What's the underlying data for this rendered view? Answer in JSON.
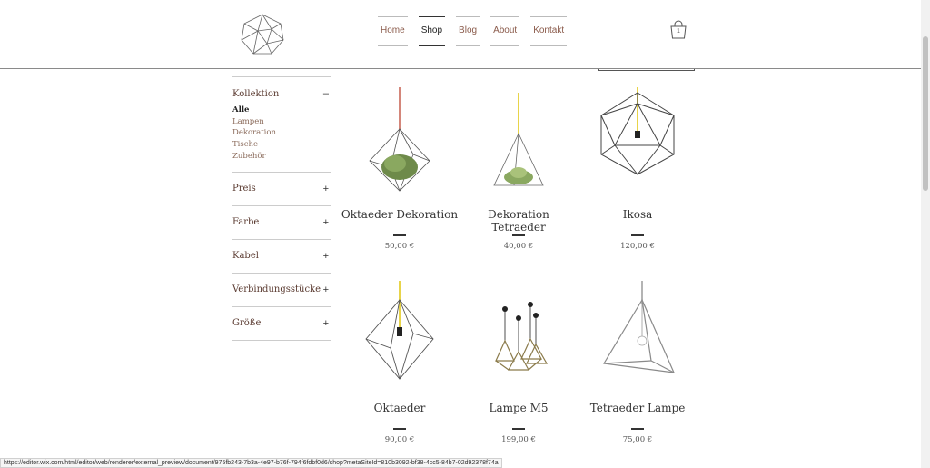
{
  "header": {
    "logo_icon": "geodesic-logo-icon",
    "nav": [
      "Home",
      "Shop",
      "Blog",
      "About",
      "Kontakt"
    ],
    "active_nav": "Shop",
    "cart_count": "1",
    "cart_icon": "shopping-bag-icon"
  },
  "sidebar": {
    "collection": {
      "label": "Kollektion",
      "toggle": "–",
      "items": [
        "Alle",
        "Lampen",
        "Dekoration",
        "Tische",
        "Zubehör"
      ],
      "active_item": "Alle"
    },
    "filters": [
      {
        "label": "Preis",
        "toggle": "+"
      },
      {
        "label": "Farbe",
        "toggle": "+"
      },
      {
        "label": "Kabel",
        "toggle": "+"
      },
      {
        "label": "Verbindungsstücke",
        "toggle": "+"
      },
      {
        "label": "Größe",
        "toggle": "+"
      }
    ]
  },
  "products": [
    {
      "name": "Oktaeder Dekoration",
      "price": "50,00 €",
      "image": "octahedron-plant-icon",
      "cord_color": "#d4867a"
    },
    {
      "name": "Dekoration Tetraeder",
      "price": "40,00 €",
      "image": "tetrahedron-plant-icon",
      "cord_color": "#e8d44a"
    },
    {
      "name": "Ikosa",
      "price": "120,00 €",
      "image": "icosahedron-lamp-icon",
      "cord_color": "#e8d44a"
    },
    {
      "name": "Oktaeder",
      "price": "90,00 €",
      "image": "octahedron-lamp-icon",
      "cord_color": "#e8d44a"
    },
    {
      "name": "Lampe M5",
      "price": "199,00 €",
      "image": "pendant-cluster-icon",
      "cord_color": "#222222"
    },
    {
      "name": "Tetraeder Lampe",
      "price": "75,00 €",
      "image": "tetrahedron-lamp-icon",
      "cord_color": "#9a9a9a"
    }
  ],
  "status_url": "https://editor.wix.com/html/editor/web/renderer/external_preview/document/975fb243-7b3a-4e97-b76f-794f6fdbf0d6/shop?metaSiteId=810b3092-bf38-4cc5-84b7-02d92378f74a",
  "colors": {
    "accent_text": "#8a5a4a",
    "rule": "#cccccc"
  }
}
